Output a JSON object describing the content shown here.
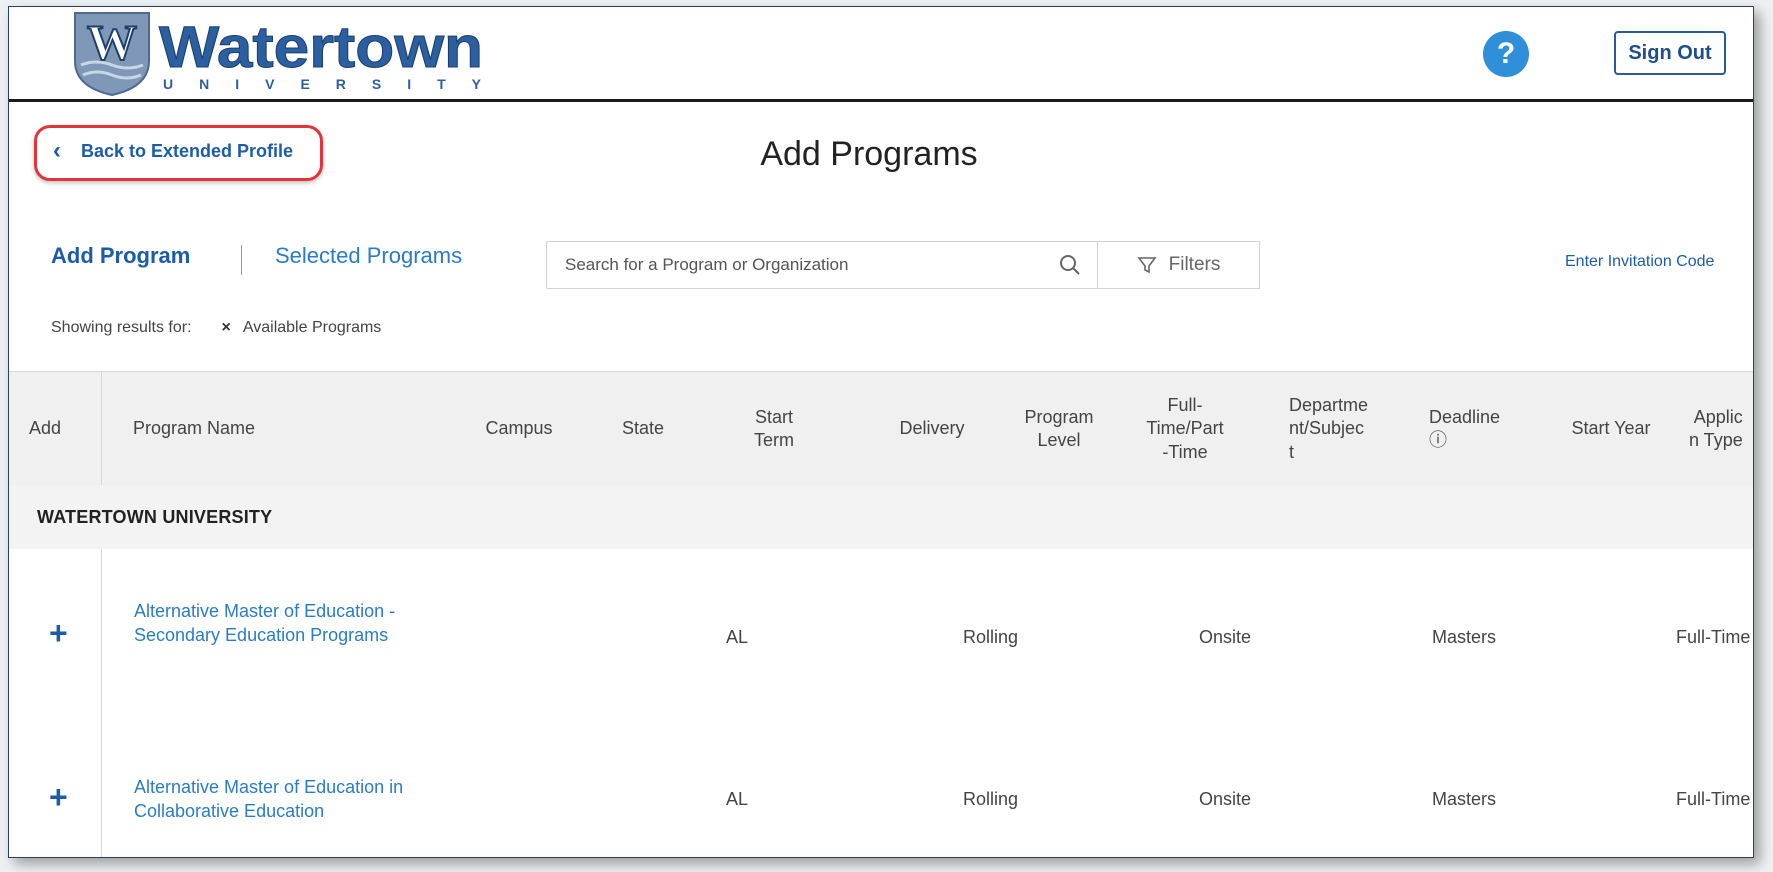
{
  "header": {
    "logo_letter": "W",
    "logo_name": "Watertown",
    "logo_sub": "UNIVERSITY",
    "help_glyph": "?",
    "sign_out_label": "Sign Out"
  },
  "nav": {
    "back_label": "Back to Extended Profile",
    "page_title": "Add Programs"
  },
  "tabs": [
    {
      "label": "Add Program"
    },
    {
      "label": "Selected Programs"
    }
  ],
  "search": {
    "placeholder": "Search for a Program or Organization",
    "filters_label": "Filters",
    "invitation_label": "Enter Invitation Code"
  },
  "results": {
    "showing_label": "Showing results for:",
    "chip_x": "×",
    "chip_label": "Available Programs"
  },
  "table": {
    "columns": [
      {
        "label": "Add"
      },
      {
        "label": "Program Name"
      },
      {
        "label": "Campus"
      },
      {
        "label": "State"
      },
      {
        "label": "Start\nTerm"
      },
      {
        "label": "Delivery"
      },
      {
        "label": "Program\nLevel"
      },
      {
        "label": "Full-\nTime/Part\n-Time"
      },
      {
        "label": "Departme\nnt/Subjec\nt"
      },
      {
        "label": "Deadline\nⓘ"
      },
      {
        "label": "Start Year"
      },
      {
        "label": "Applic\nn Type"
      }
    ],
    "group": "WATERTOWN UNIVERSITY",
    "rows": [
      {
        "add": "+",
        "name": "Alternative Master of Education - Secondary Education Programs",
        "state": "AL",
        "start_term": "Rolling",
        "delivery": "Onsite",
        "level": "Masters",
        "full_part": "Full-Time"
      },
      {
        "add": "+",
        "name": "Alternative Master of Education in Collaborative Education",
        "state": "AL",
        "start_term": "Rolling",
        "delivery": "Onsite",
        "level": "Masters",
        "full_part": "Full-Time"
      }
    ]
  },
  "colors": {
    "brand_blue": "#1d5ca8",
    "link_blue": "#2b7cc8",
    "highlight_red": "#e0353a",
    "help_blue": "#2f8fd8"
  }
}
